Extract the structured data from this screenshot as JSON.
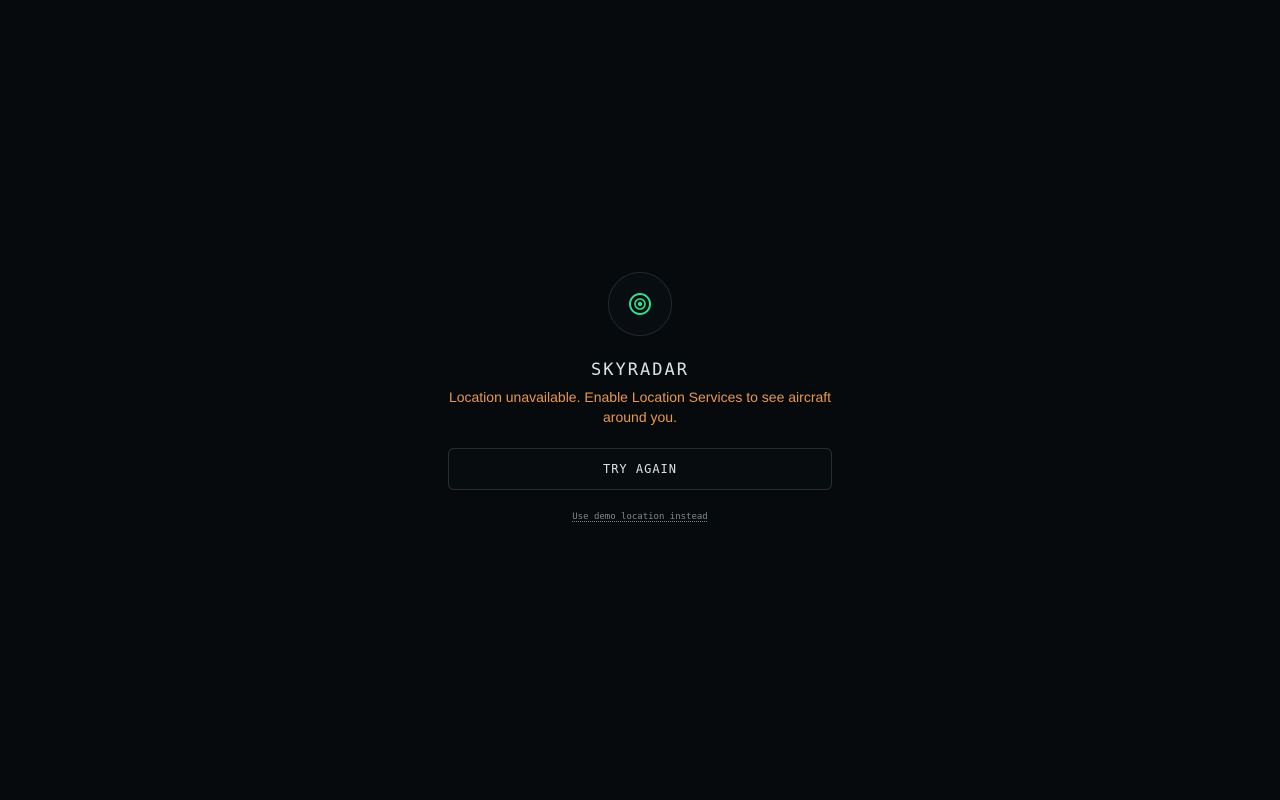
{
  "app": {
    "title": "SKYRADAR",
    "logo_icon": "radar-target-icon",
    "accent_color": "#2ee08a"
  },
  "status": {
    "message": "Location unavailable. Enable Location Services to see aircraft around you.",
    "color": "#e8974a"
  },
  "actions": {
    "retry_label": "TRY AGAIN",
    "demo_label": "Use demo location instead"
  }
}
